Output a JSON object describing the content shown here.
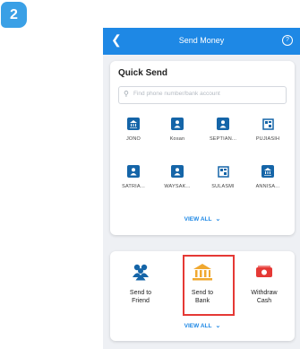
{
  "step": {
    "number": "2"
  },
  "app": {
    "title": "Send Money",
    "back_icon": "chevron-left-icon",
    "help_icon": "question-circle-icon",
    "colors": {
      "primary": "#1e88e5",
      "bank_icon": "#1565a8",
      "withdraw_icon": "#e53935",
      "highlight": "#e53935"
    }
  },
  "quick_send": {
    "title": "Quick Send",
    "search_placeholder": "Find phone number/bank account",
    "contacts": [
      {
        "label": "JONO",
        "icon": "bank-icon"
      },
      {
        "label": "Kosan",
        "icon": "person-icon"
      },
      {
        "label": "SEPTIAN...",
        "icon": "person-icon"
      },
      {
        "label": "PUJIASIH",
        "icon": "qr-icon"
      },
      {
        "label": "SATRIA...",
        "icon": "person-icon"
      },
      {
        "label": "WAYSAK...",
        "icon": "person-icon"
      },
      {
        "label": "SULASMI",
        "icon": "qr-icon"
      },
      {
        "label": "ANNISA...",
        "icon": "bank-icon"
      }
    ],
    "view_all": "VIEW ALL"
  },
  "actions": {
    "items": [
      {
        "label_line1": "Send to",
        "label_line2": "Friend",
        "icon": "friends-icon"
      },
      {
        "label_line1": "Send to",
        "label_line2": "Bank",
        "icon": "bank-building-icon",
        "highlighted": true
      },
      {
        "label_line1": "Withdraw",
        "label_line2": "Cash",
        "icon": "cash-icon"
      }
    ],
    "view_all": "VIEW ALL"
  }
}
